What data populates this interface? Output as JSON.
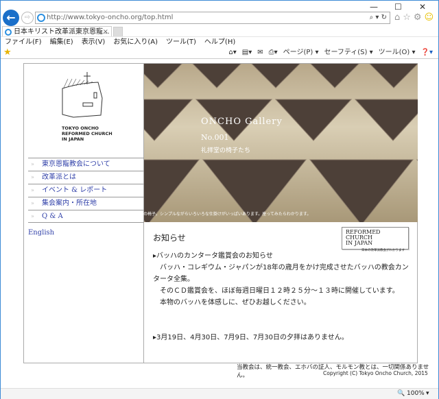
{
  "browser": {
    "url": "http://www.tokyo-oncho.org/top.html",
    "tab_title": "日本キリスト改革派東京恩寵...",
    "window_controls": [
      "—",
      "☐",
      "✕"
    ],
    "menu": [
      "ファイル(F)",
      "編集(E)",
      "表示(V)",
      "お気に入り(A)",
      "ツール(T)",
      "ヘルプ(H)"
    ],
    "commands": [
      "ページ(P) ▾",
      "セーフティ(S) ▾",
      "ツール(O) ▾"
    ],
    "zoom": "100%"
  },
  "logo": {
    "text": [
      "TOKYO ONCHO",
      "REFORMED CHURCH",
      "IN JAPAN"
    ]
  },
  "nav": [
    "東京恩寵教会について",
    "改革派とは",
    "イベント & レポート",
    "集会案内・所在地",
    "Q & A"
  ],
  "english_link": "English",
  "gallery": {
    "title": "ONCHO Gallery",
    "number": "No.001",
    "subtitle": "礼拝堂の椅子たち",
    "caption": "逆三角形の背もたれもユニークな礼拝堂の椅子。シンプルながらいろいろな仕掛けがいっぱいあります。座ってみたらわかります。"
  },
  "banner": {
    "line1": "REFORMED CHURCH",
    "line2": "IN JAPAN",
    "sub": "日本の改革派教会がわかります"
  },
  "news": {
    "heading": "お知らせ",
    "lines": [
      "▸バッハのカンタータ鑑賞会のお知らせ",
      "　バッハ・コレギウム・ジャパンが18年の歳月をかけ完成させたバッハの教会カンタータ全集。",
      "　そのＣＤ鑑賞会を、ほぼ毎週日曜日１２時２５分～１３時に開催しています。",
      "　本物のバッハを体感しに、ぜひお越しください。",
      "",
      "",
      "▸3月19日、4月30日、7月9日、7月30日の夕拝はありません。"
    ]
  },
  "footer": {
    "disclaimer": "当教会は、統一教会、エホバの証人、モルモン教とは、一切関係ありません。",
    "copyright": "Copyright (C) Tokyo Oncho Church, 2015"
  }
}
